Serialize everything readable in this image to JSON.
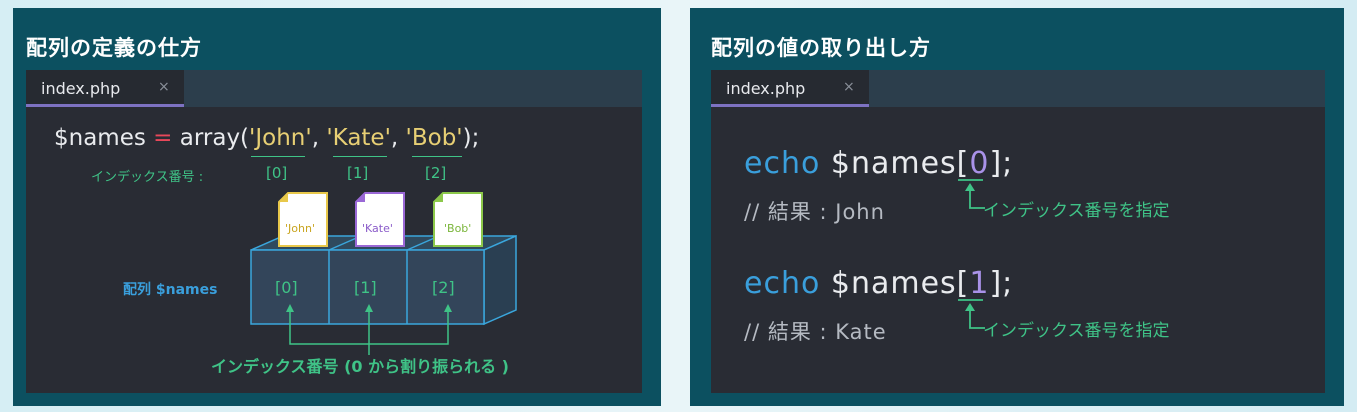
{
  "left": {
    "title": "配列の定義の仕方",
    "tab": {
      "label": "index.php",
      "close": "×"
    },
    "code": {
      "var": "$names",
      "eq": "=",
      "func": "array(",
      "q1": "'John'",
      "q2": "'Kate'",
      "q3": "'Bob'",
      "comma": ",",
      "end": ");"
    },
    "index_label": "インデックス番号 :",
    "indices": [
      "[0]",
      "[1]",
      "[2]"
    ],
    "docs": [
      "'John'",
      "'Kate'",
      "'Bob'"
    ],
    "doc_colors": [
      "#e8c84a",
      "#9a68d6",
      "#8cc84a"
    ],
    "array_label": "配列 $names",
    "note": "インデックス番号 (0 から割り振られる )"
  },
  "right": {
    "title": "配列の値の取り出し方",
    "tab": {
      "label": "index.php",
      "close": "×"
    },
    "blocks": [
      {
        "echo": "echo",
        "var": "$names[",
        "index": "0",
        "close": "];",
        "comment": "// 結果 : John",
        "note": "インデックス番号を指定"
      },
      {
        "echo": "echo",
        "var": "$names[",
        "index": "1",
        "close": "];",
        "comment": "// 結果 : Kate",
        "note": "インデックス番号を指定"
      }
    ]
  },
  "colors": {
    "panel_bg": "#0c5060",
    "editor_bg": "#292c34",
    "tab_accent": "#7d72c2",
    "string": "#e7cf74",
    "keyword": "#3a9fdc",
    "index_green": "#3fc387",
    "operator": "#e8485a"
  }
}
